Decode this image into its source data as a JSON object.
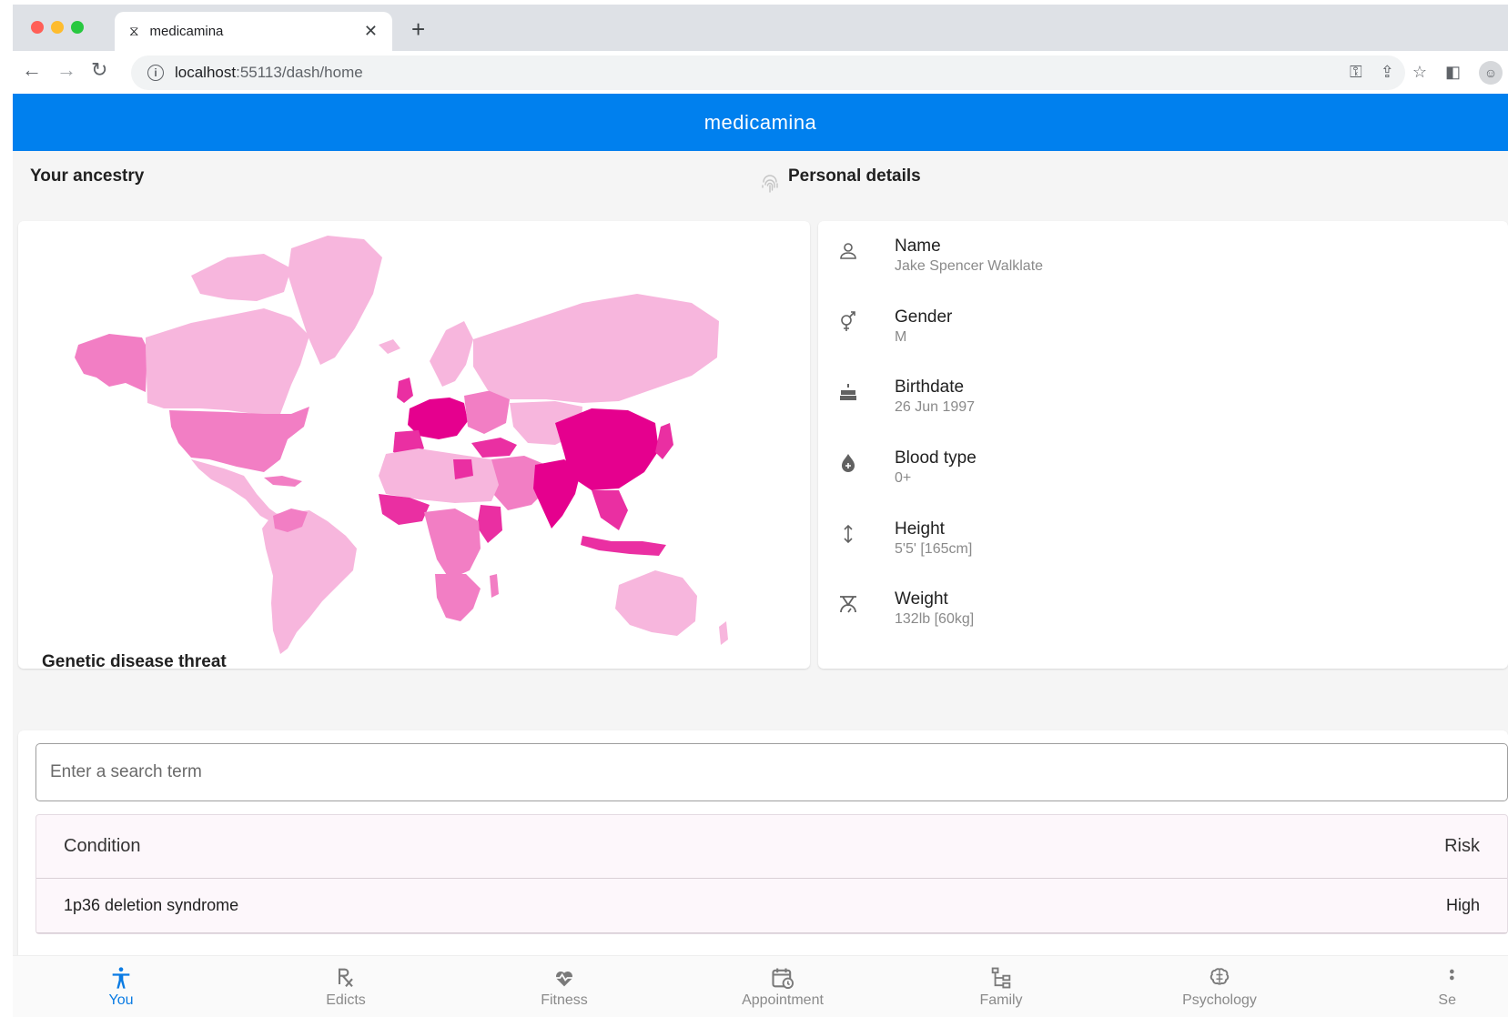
{
  "browser": {
    "tab_title": "medicamina",
    "url_host": "localhost",
    "url_path": ":55113/dash/home"
  },
  "app": {
    "title": "medicamina"
  },
  "ancestry": {
    "title": "Your ancestry"
  },
  "personal": {
    "title": "Personal details",
    "fields": [
      {
        "label": "Name",
        "value": "Jake Spencer Walklate",
        "icon": "person-icon"
      },
      {
        "label": "Gender",
        "value": "M",
        "icon": "gender-icon"
      },
      {
        "label": "Birthdate",
        "value": "26 Jun 1997",
        "icon": "cake-icon"
      },
      {
        "label": "Blood type",
        "value": "0+",
        "icon": "blood-drop-icon"
      },
      {
        "label": "Height",
        "value": "5'5' [165cm]",
        "icon": "height-icon"
      },
      {
        "label": "Weight",
        "value": "132lb [60kg]",
        "icon": "scale-icon"
      }
    ]
  },
  "genetic": {
    "title": "Genetic disease threat",
    "search_placeholder": "Enter a search term",
    "col_condition": "Condition",
    "col_risk": "Risk",
    "rows": [
      {
        "condition": "1p36 deletion syndrome",
        "risk": "High"
      }
    ]
  },
  "nav": {
    "items": [
      {
        "label": "You",
        "icon": "accessibility-icon",
        "active": true
      },
      {
        "label": "Edicts",
        "icon": "prescription-icon"
      },
      {
        "label": "Fitness",
        "icon": "heart-pulse-icon"
      },
      {
        "label": "Appointment",
        "icon": "calendar-clock-icon"
      },
      {
        "label": "Family",
        "icon": "family-tree-icon"
      },
      {
        "label": "Psychology",
        "icon": "brain-icon"
      },
      {
        "label": "Se",
        "icon": "more-icon"
      }
    ]
  },
  "colors": {
    "appbar": "#0080ee",
    "map_light": "#f7b6dd",
    "map_mid": "#f27ec4",
    "map_strong": "#ea2fa2",
    "map_max": "#e5008e",
    "active_nav": "#0a7be3"
  }
}
